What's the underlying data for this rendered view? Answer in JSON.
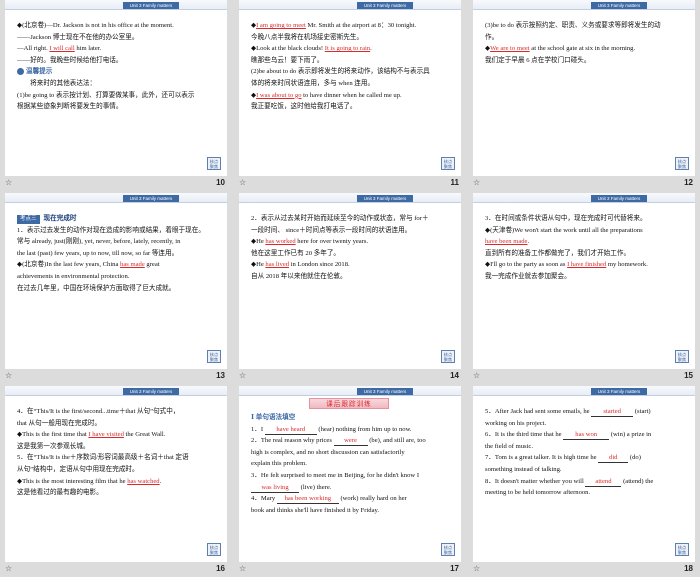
{
  "header_tab": "Unit 3   Family matters",
  "badge": [
    "核点",
    "聚焦"
  ],
  "star_glyph": "☆",
  "slides": [
    {
      "number": "10",
      "lines": [
        [
          {
            "t": "◆(北京卷)—Dr. Jackson is not in his office at the moment."
          }
        ],
        [
          {
            "t": "——Jackson 博士现在不在他的办公室里。"
          }
        ],
        [
          {
            "t": "—All right. "
          },
          {
            "t": "I will call",
            "cls": "u red"
          },
          {
            "t": " him later."
          }
        ],
        [
          {
            "t": "——好的。我晚些时候给他打电话。"
          }
        ],
        [
          {
            "t": "温馨提示",
            "cls": "tip-label",
            "icon": true
          }
        ],
        [
          {
            "t": "　　将来时的其他表达法："
          }
        ],
        [
          {
            "t": "(1)be going to 表示按计划、打算要做某事，此外，还可以表示"
          }
        ],
        [
          {
            "t": "根据某些迹象判断将要发生的事情。"
          }
        ]
      ]
    },
    {
      "number": "11",
      "lines": [
        [
          {
            "t": "◆"
          },
          {
            "t": "I am going to meet",
            "cls": "u red"
          },
          {
            "t": " Mr. Smith at the airport at 8：30 tonight."
          }
        ],
        [
          {
            "t": "今晚八点半我将在机场接史密斯先生。"
          }
        ],
        [
          {
            "t": "◆Look at the black clouds! "
          },
          {
            "t": "It is going to rain",
            "cls": "u red"
          },
          {
            "t": "."
          }
        ],
        [
          {
            "t": "瞧那些乌云！要下雨了。"
          }
        ],
        [
          {
            "t": "(2)be about to do 表示即将发生的将来动作，该结构不与表示具"
          }
        ],
        [
          {
            "t": "体的将来时间状语连用，多与 when 连用。"
          }
        ],
        [
          {
            "t": "◆"
          },
          {
            "t": "I was about to go",
            "cls": "u red"
          },
          {
            "t": " to have dinner when he called me up."
          }
        ],
        [
          {
            "t": "我正要吃饭，这时他给我打电话了。"
          }
        ]
      ]
    },
    {
      "number": "12",
      "lines": [
        [
          {
            "t": ""
          }
        ],
        [
          {
            "t": "(3)be to do 表示按照约定、职责、义务或要求等即将发生的动"
          }
        ],
        [
          {
            "t": "作。"
          }
        ],
        [
          {
            "t": "◆"
          },
          {
            "t": "We are to meet",
            "cls": "u red"
          },
          {
            "t": " at the school gate at six in the morning."
          }
        ],
        [
          {
            "t": "我们定于早晨 6 点在学校门口碰头。"
          }
        ]
      ]
    },
    {
      "number": "13",
      "topic": {
        "tag": "考点三",
        "title": "现在完成时"
      },
      "lines": [
        [
          {
            "t": "1．表示过去发生的动作对现在造成的影响或结果，着眼于现在。"
          }
        ],
        [
          {
            "t": "常与 already, just(刚刚), yet, never, before, lately, recently, in"
          }
        ],
        [
          {
            "t": "the last (past) few years, up to now, till now, so far 等连用。"
          }
        ],
        [
          {
            "t": "◆(北京卷)In the last few years, China "
          },
          {
            "t": "has made",
            "cls": "u red"
          },
          {
            "t": " great"
          }
        ],
        [
          {
            "t": "achievements in environmental protection."
          }
        ],
        [
          {
            "t": "在过去几年里，中国在环境保护方面取得了巨大成就。"
          }
        ]
      ]
    },
    {
      "number": "14",
      "lines": [
        [
          {
            "t": "2．表示从过去某时开始而延续至今的动作或状态，常与 for＋"
          }
        ],
        [
          {
            "t": "一段时间、 since＋时间点等表示一段时间的状语连用。"
          }
        ],
        [
          {
            "t": "◆He "
          },
          {
            "t": "has worked",
            "cls": "u red"
          },
          {
            "t": " here for over twenty years."
          }
        ],
        [
          {
            "t": "他在这里工作已有 20 多年了。"
          }
        ],
        [
          {
            "t": "◆He "
          },
          {
            "t": "has lived",
            "cls": "u red"
          },
          {
            "t": " in London since 2018."
          }
        ],
        [
          {
            "t": "自从 2018 年以来他就住在伦敦。"
          }
        ]
      ]
    },
    {
      "number": "15",
      "lines": [
        [
          {
            "t": "3．在时间或条件状语从句中，现在完成时可代替将来。"
          }
        ],
        [
          {
            "t": "◆(天津卷)We won't start the work until all the preparations"
          }
        ],
        [
          {
            "t": "have been made",
            "cls": "u red"
          },
          {
            "t": "."
          }
        ],
        [
          {
            "t": "直到所有的准备工作都做完了，我们才开始工作。"
          }
        ],
        [
          {
            "t": "◆I'll go to the party as soon as "
          },
          {
            "t": "I have finished",
            "cls": "u red"
          },
          {
            "t": " my homework."
          }
        ],
        [
          {
            "t": "我一完成作业就去参加聚会。"
          }
        ]
      ]
    },
    {
      "number": "16",
      "lines": [
        [
          {
            "t": ""
          }
        ],
        [
          {
            "t": "4．在“This/It is the first/second...time＋that 从句”句式中，"
          }
        ],
        [
          {
            "t": "that 从句一般用现在完成时。"
          }
        ],
        [
          {
            "t": "◆This is the first time that "
          },
          {
            "t": "I have visited",
            "cls": "u red"
          },
          {
            "t": " the Great Wall."
          }
        ],
        [
          {
            "t": "这是我第一次参观长城。"
          }
        ],
        [
          {
            "t": "5．在“This/It is the＋序数词/形容词最高级＋名词＋that 定语"
          }
        ],
        [
          {
            "t": "从句”结构中，定语从句中用现在完成时。"
          }
        ],
        [
          {
            "t": "◆This is the most interesting film that he "
          },
          {
            "t": "has watched",
            "cls": "u red"
          },
          {
            "t": "."
          }
        ],
        [
          {
            "t": "这是他看过的最有趣的电影。"
          }
        ]
      ]
    },
    {
      "number": "17",
      "banner": "课后跟踪训练",
      "lines": [
        [
          {
            "t": "Ⅰ  单句语法填空",
            "cls": "sec-head"
          }
        ],
        [
          {
            "t": "1．I "
          },
          {
            "blank": "have heard",
            "w": 52
          },
          {
            "t": " (hear) nothing from him up to now."
          }
        ],
        [
          {
            "t": "2．The real reason why prices "
          },
          {
            "blank": "were",
            "w": 34
          },
          {
            "t": " (be), and still are, too"
          }
        ],
        [
          {
            "t": "high is complex, and no short discussion can satisfactorily"
          }
        ],
        [
          {
            "t": "explain this problem."
          }
        ],
        [
          {
            "t": "3．He felt surprised to meet me in Beijing, for he didn't know I"
          }
        ],
        [
          {
            "blank": "was living",
            "w": 48
          },
          {
            "t": " (live) there."
          }
        ],
        [
          {
            "t": "4．Mary "
          },
          {
            "blank": "has been working",
            "w": 62
          },
          {
            "t": " (work) really hard on her"
          }
        ],
        [
          {
            "t": "book and thinks she'll have finished it by Friday."
          }
        ]
      ]
    },
    {
      "number": "18",
      "lines": [
        [
          {
            "t": "5．After Jack had sent some emails, he "
          },
          {
            "blank": "started",
            "w": 42
          },
          {
            "t": " (start)"
          }
        ],
        [
          {
            "t": "working on his project."
          }
        ],
        [
          {
            "t": "6．It is the third time that he "
          },
          {
            "blank": "has won",
            "w": 46
          },
          {
            "t": " (win) a prize in"
          }
        ],
        [
          {
            "t": "the field of music."
          }
        ],
        [
          {
            "t": "7．Tom is a great talker. It is high time he "
          },
          {
            "blank": "did",
            "w": 30
          },
          {
            "t": " (do)"
          }
        ],
        [
          {
            "t": "something instead of talking."
          }
        ],
        [
          {
            "t": "8．It doesn't matter whether you will "
          },
          {
            "blank": "attend",
            "w": 36
          },
          {
            "t": " (attend) the"
          }
        ],
        [
          {
            "t": "meeting to be held tomorrow afternoon."
          }
        ]
      ]
    }
  ]
}
